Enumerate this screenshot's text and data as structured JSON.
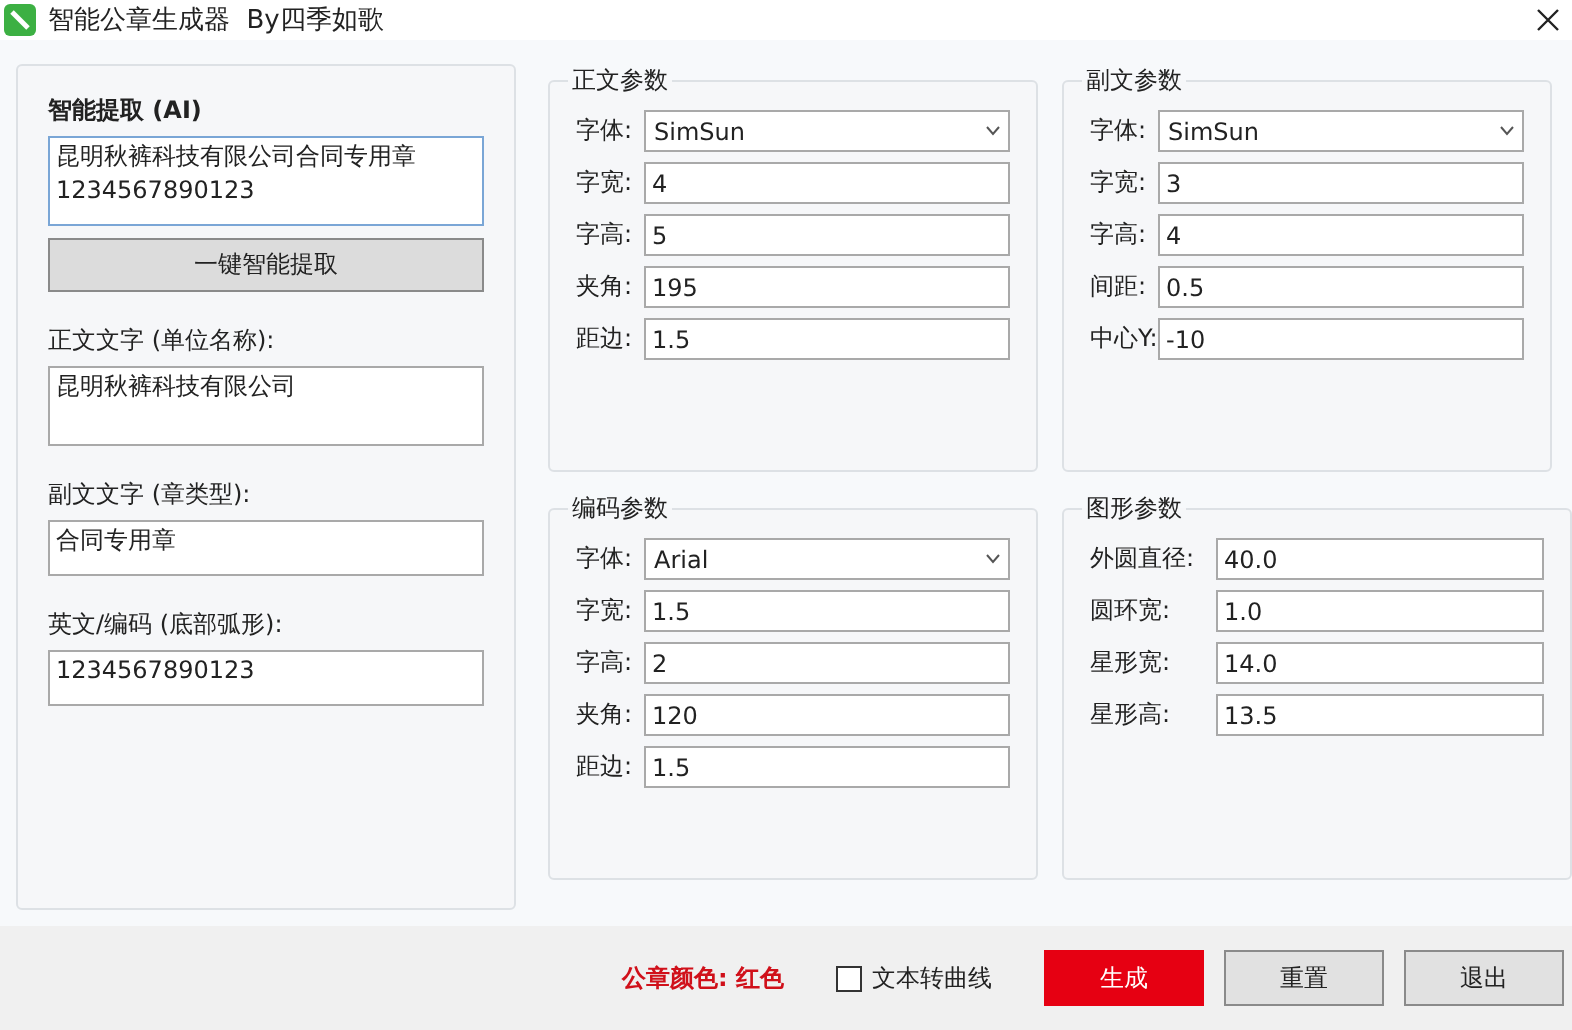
{
  "window": {
    "title": "智能公章生成器  By四季如歌"
  },
  "left_panel": {
    "ai_title": "智能提取 (AI)",
    "ai_input": "昆明秋裤科技有限公司合同专用章\n1234567890123",
    "extract_button": "一键智能提取",
    "fields": [
      {
        "label": "正文文字 (单位名称):",
        "value": "昆明秋裤科技有限公司",
        "multiline": true
      },
      {
        "label": "副文文字 (章类型):",
        "value": "合同专用章",
        "multiline": false
      },
      {
        "label": "英文/编码 (底部弧形):",
        "value": "1234567890123",
        "multiline": false
      }
    ]
  },
  "groups": [
    {
      "title": "正文参数",
      "fields": [
        {
          "kind": "select",
          "label": "字体:",
          "value": "SimSun"
        },
        {
          "kind": "input",
          "label": "字宽:",
          "value": "4"
        },
        {
          "kind": "input",
          "label": "字高:",
          "value": "5"
        },
        {
          "kind": "input",
          "label": "夹角:",
          "value": "195"
        },
        {
          "kind": "input",
          "label": "距边:",
          "value": "1.5"
        }
      ]
    },
    {
      "title": "副文参数",
      "fields": [
        {
          "kind": "select",
          "label": "字体:",
          "value": "SimSun"
        },
        {
          "kind": "input",
          "label": "字宽:",
          "value": "3"
        },
        {
          "kind": "input",
          "label": "字高:",
          "value": "4"
        },
        {
          "kind": "input",
          "label": "间距:",
          "value": "0.5"
        },
        {
          "kind": "input",
          "label": "中心Y:",
          "value": "-10"
        }
      ]
    },
    {
      "title": "编码参数",
      "fields": [
        {
          "kind": "select",
          "label": "字体:",
          "value": "Arial"
        },
        {
          "kind": "input",
          "label": "字宽:",
          "value": "1.5"
        },
        {
          "kind": "input",
          "label": "字高:",
          "value": "2"
        },
        {
          "kind": "input",
          "label": "夹角:",
          "value": "120"
        },
        {
          "kind": "input",
          "label": "距边:",
          "value": "1.5"
        }
      ]
    },
    {
      "title": "图形参数",
      "fields": [
        {
          "kind": "input",
          "label": "外圆直径:",
          "value": "40.0"
        },
        {
          "kind": "input",
          "label": "圆环宽:",
          "value": "1.0"
        },
        {
          "kind": "input",
          "label": "星形宽:",
          "value": "14.0"
        },
        {
          "kind": "input",
          "label": "星形高:",
          "value": "13.5"
        }
      ]
    }
  ],
  "footer": {
    "seal_color": "公章颜色: 红色",
    "curve_text": {
      "label": "文本转曲线",
      "checked": false
    },
    "buttons": [
      {
        "label": "生成",
        "kind": "primary"
      },
      {
        "label": "重置",
        "kind": "normal"
      },
      {
        "label": "退出",
        "kind": "normal"
      }
    ]
  }
}
